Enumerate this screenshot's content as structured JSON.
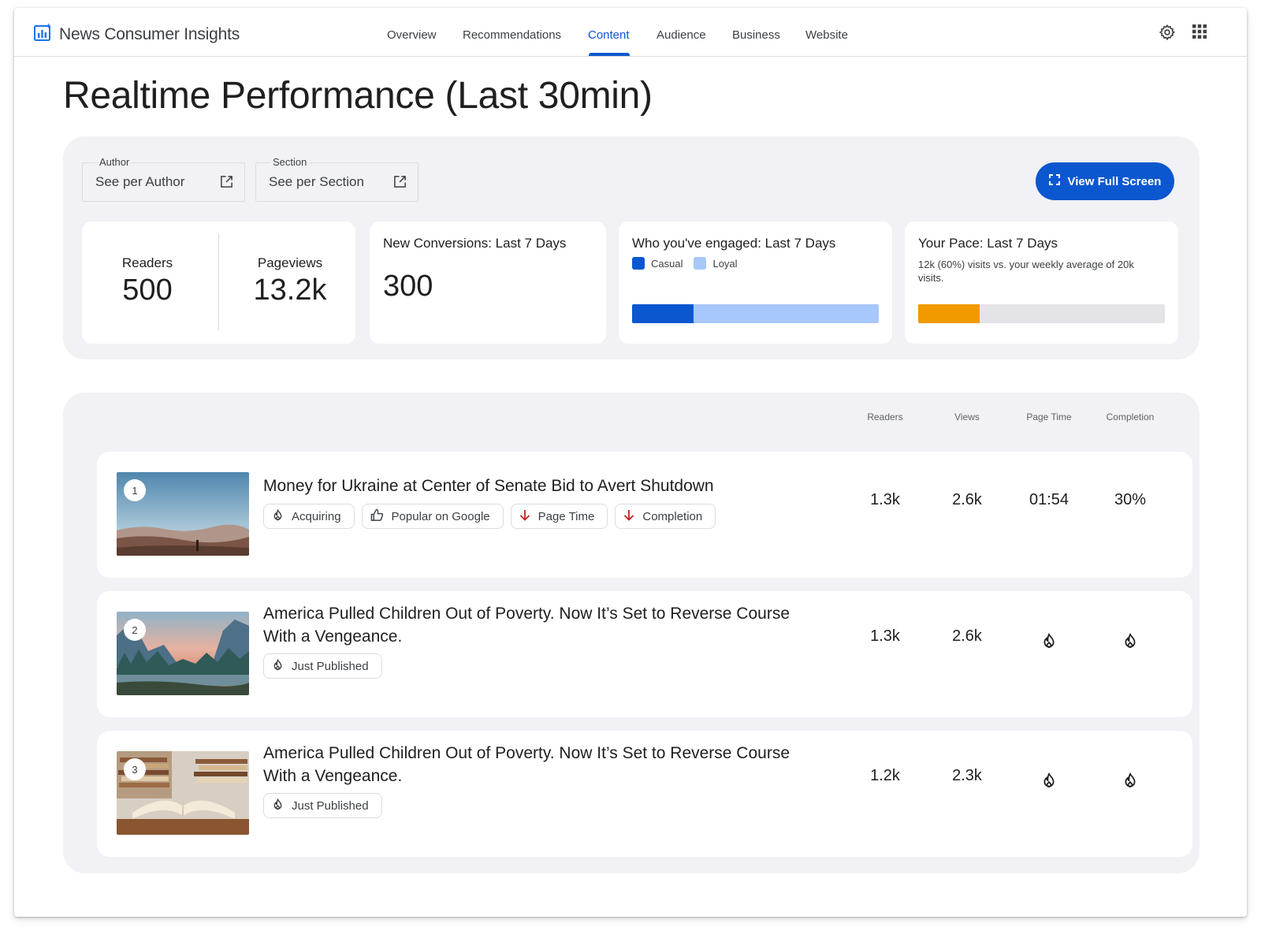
{
  "app": {
    "title": "News Consumer Insights"
  },
  "nav": {
    "tabs": [
      {
        "label": "Overview"
      },
      {
        "label": "Recommendations"
      },
      {
        "label": "Content"
      },
      {
        "label": "Audience"
      },
      {
        "label": "Business"
      },
      {
        "label": "Website"
      }
    ],
    "active": "Content"
  },
  "header_icons": [
    "settings-gear-icon",
    "apps-grid-icon"
  ],
  "page": {
    "title": "Realtime Performance (Last 30min)"
  },
  "filters": {
    "author": {
      "label": "Author",
      "value": "See per Author"
    },
    "section": {
      "label": "Section",
      "value": "See per Section"
    },
    "fullscreen_label": "View Full Screen"
  },
  "stats": {
    "readers": {
      "label": "Readers",
      "value": "500"
    },
    "pageviews": {
      "label": "Pageviews",
      "value": "13.2k"
    },
    "conversions": {
      "title": "New Conversions: Last 7 Days",
      "value": "300"
    },
    "engaged": {
      "title": "Who you've engaged: Last 7 Days",
      "legend": [
        {
          "label": "Casual",
          "color": "#0b57d0"
        },
        {
          "label": "Loyal",
          "color": "#a8c7fa"
        }
      ],
      "casual_fraction": 0.25
    },
    "pace": {
      "title": "Your Pace: Last 7 Days",
      "text": "12k (60%) visits vs. your weekly average of 20k visits.",
      "fill_fraction": 0.25,
      "fill_color": "#f29900",
      "track_color": "#e3e3e8"
    }
  },
  "table": {
    "columns": [
      "Readers",
      "Views",
      "Page Time",
      "Completion"
    ],
    "rows": [
      {
        "rank": "1",
        "title": "Money for Ukraine at Center of Senate Bid to Avert Shutdown",
        "chips": [
          {
            "label": "Acquiring",
            "icon": "flame-icon"
          },
          {
            "label": "Popular on Google",
            "icon": "thumbs-up-icon"
          },
          {
            "label": "Page Time",
            "icon": "arrow-down-icon"
          },
          {
            "label": "Completion",
            "icon": "arrow-down-icon"
          }
        ],
        "readers": "1.3k",
        "views": "2.6k",
        "page_time": "01:54",
        "completion": "30%"
      },
      {
        "rank": "2",
        "title": "America Pulled Children Out of Poverty. Now It’s Set to Reverse Course With a Vengeance.",
        "chips": [
          {
            "label": "Just Published",
            "icon": "flame-icon"
          }
        ],
        "readers": "1.3k",
        "views": "2.6k",
        "page_time_icon": "flame-icon",
        "completion_icon": "flame-icon"
      },
      {
        "rank": "3",
        "title": "America Pulled Children Out of Poverty. Now It’s Set to Reverse Course With a Vengeance.",
        "chips": [
          {
            "label": "Just Published",
            "icon": "flame-icon"
          }
        ],
        "readers": "1.2k",
        "views": "2.3k",
        "page_time_icon": "flame-icon",
        "completion_icon": "flame-icon"
      }
    ]
  }
}
